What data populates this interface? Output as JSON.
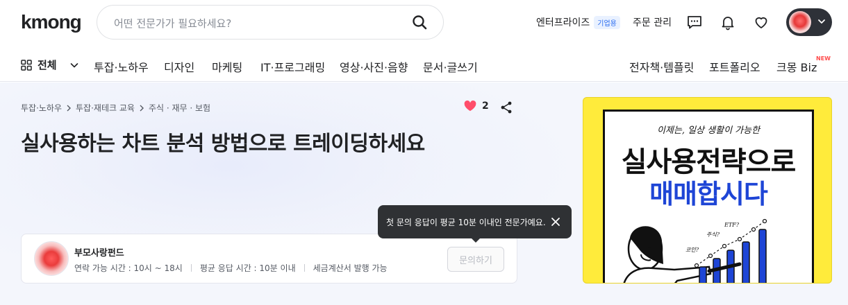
{
  "header": {
    "logo": "kmong",
    "search_placeholder": "어떤 전문가가 필요하세요?",
    "enterprise": "엔터프라이즈",
    "enterprise_badge": "기업용",
    "orders": "주문 관리"
  },
  "nav": {
    "all": "전체",
    "categories": [
      "투잡·노하우",
      "디자인",
      "마케팅",
      "IT·프로그래밍",
      "영상·사진·음향",
      "문서·글쓰기"
    ],
    "right": [
      "전자책·템플릿",
      "포트폴리오",
      "크몽 Biz"
    ],
    "new_badge": "NEW"
  },
  "breadcrumb": [
    "투잡·노하우",
    "투잡·재테크 교육",
    "주식 · 재무 · 보험"
  ],
  "likes": "2",
  "title": "실사용하는 차트 분석 방법으로 트레이딩하세요",
  "tooltip": "첫 문의 응답이 평균 10분 이내인 전문가예요.",
  "seller": {
    "name": "부모사랑펀드",
    "contact_hours": "연락 가능 시간 : 10시 ~ 18시",
    "avg_response": "평균 응답 시간 : 10분 이내",
    "tax_invoice": "세금계산서 발행 가능",
    "inquiry_button": "문의하기"
  },
  "banner": {
    "tagline": "이제는, 일상 생활이 가능한",
    "line1": "실사용전략으로",
    "line2": "매매합시다",
    "chart_notes": [
      "주식?",
      "ETF?",
      "코인?"
    ]
  },
  "colors": {
    "like": "#ff4d6a",
    "badge_blue": "#2a6df0",
    "banner_yellow": "#ffeb3b",
    "banner_blue": "#1e45d6"
  }
}
